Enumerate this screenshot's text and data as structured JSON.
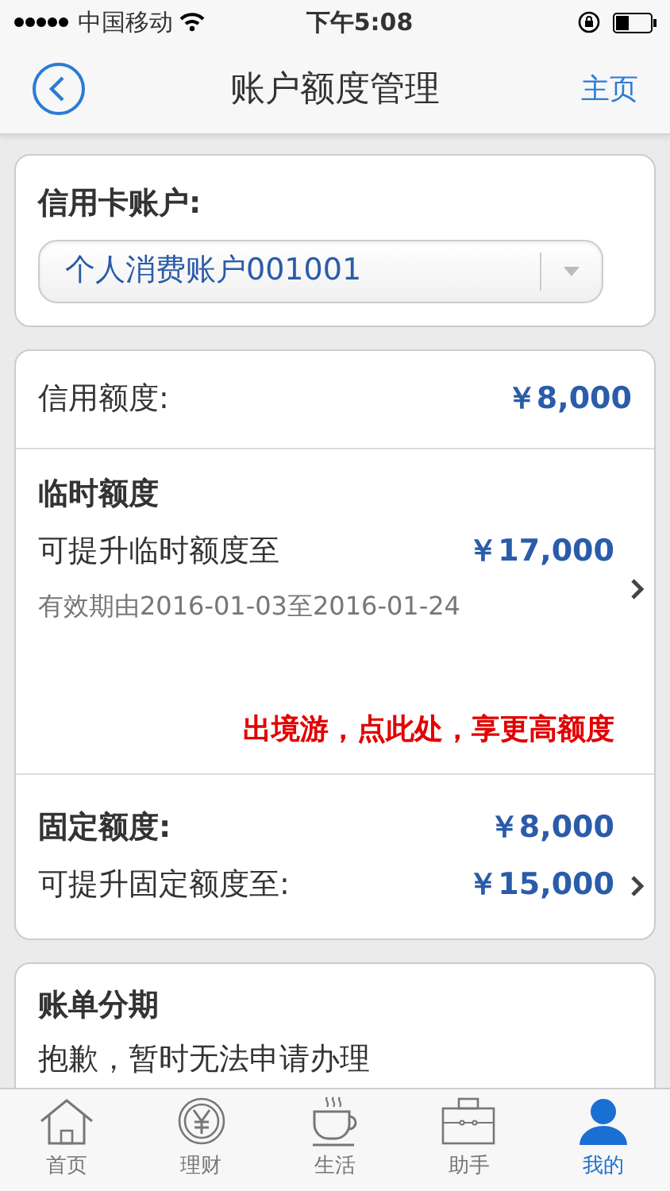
{
  "status_bar": {
    "carrier": "中国移动",
    "time": "下午5:08"
  },
  "nav": {
    "title": "账户额度管理",
    "home_link": "主页"
  },
  "account_card": {
    "label": "信用卡账户:",
    "select_value": "个人消费账户001001"
  },
  "limits": {
    "credit": {
      "label": "信用额度:",
      "value": "￥8,000"
    },
    "temporary": {
      "title": "临时额度",
      "label": "可提升临时额度至",
      "value": "￥17,000",
      "validity": "有效期由2016-01-03至2016-01-24",
      "promo": "出境游，点此处，享更高额度"
    },
    "fixed": {
      "label": "固定额度:",
      "value": "￥8,000",
      "raise_label": "可提升固定额度至:",
      "raise_value": "￥15,000"
    }
  },
  "installment": {
    "title": "账单分期",
    "message": "抱歉，暂时无法申请办理"
  },
  "tabs": [
    {
      "label": "首页",
      "kind": "home",
      "selected": false
    },
    {
      "label": "理财",
      "kind": "finance",
      "selected": false
    },
    {
      "label": "生活",
      "kind": "life",
      "selected": false
    },
    {
      "label": "助手",
      "kind": "assistant",
      "selected": false
    },
    {
      "label": "我的",
      "kind": "mine",
      "selected": true
    }
  ]
}
